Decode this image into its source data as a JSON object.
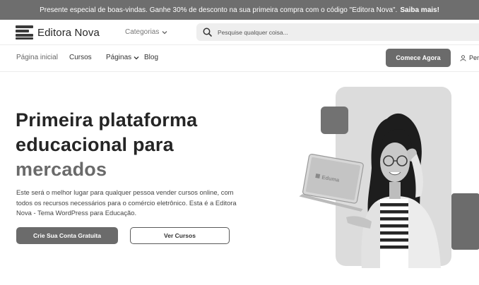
{
  "promo": {
    "text": "Presente especial de boas-vindas. Ganhe 30% de desconto na sua primeira compra com o código \"Editora Nova\".",
    "link": "Saiba mais!"
  },
  "header": {
    "logo_text": "Editora Nova",
    "categories_label": "Categorias",
    "search_placeholder": "Pesquise qualquer coisa..."
  },
  "nav": {
    "items": [
      "Página inicial",
      "Cursos",
      "Páginas",
      "Blog"
    ],
    "cta_label": "Comece Agora",
    "profile_label": "Perfil"
  },
  "hero": {
    "title_line1": "Primeira plataforma",
    "title_line2": "educacional para",
    "title_accent": "mercados",
    "description": "Este será o melhor lugar para qualquer pessoa vender cursos online, com todos os recursos necessários para o comércio eletrônico. Esta é a Editora Nova - Tema WordPress para Educação.",
    "primary_button": "Crie Sua Conta Gratuita",
    "secondary_button": "Ver Cursos",
    "laptop_brand": "Eduma"
  },
  "colors": {
    "promo_bg": "#6e6e6e",
    "button_bg": "#6b6b6b",
    "title_accent": "#6a6a6a"
  }
}
